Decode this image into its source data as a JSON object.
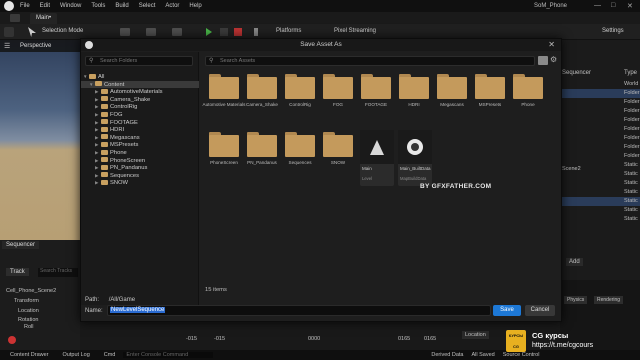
{
  "menubar": {
    "items": [
      "File",
      "Edit",
      "Window",
      "Tools",
      "Build",
      "Select",
      "Actor",
      "Help"
    ],
    "app_title": "SoM_Phone",
    "window_controls": [
      "minimize-icon",
      "maximize-icon",
      "close-icon"
    ]
  },
  "tabs": {
    "main": "Main•"
  },
  "toolbar": {
    "selection_mode": "Selection Mode",
    "platforms": "Platforms",
    "pixel_streaming": "Pixel Streaming",
    "settings": "Settings"
  },
  "viewport": {
    "mode": "Perspective"
  },
  "outliner": {
    "header_left": "Sequencer",
    "header_type": "Type",
    "rows": [
      "World",
      "Folder",
      "Folder",
      "Folder",
      "Folder",
      "Folder",
      "Folder",
      "Folder",
      "Folder",
      "Static",
      "Static",
      "Static",
      "Static",
      "Static",
      "Static",
      "Static"
    ],
    "scene_label": "Scene2",
    "add_label": "Add",
    "details_tabs": [
      "Physics",
      "Rendering"
    ]
  },
  "sequencer": {
    "title": "Sequencer",
    "track_button": "Track",
    "search_placeholder": "Search Tracks",
    "items": [
      "Cell_Phone_Scene2",
      "Transform",
      "Location",
      "Rotation",
      "Roll"
    ],
    "timeline_labels": [
      "-015",
      "-015",
      "0000",
      "0165",
      "0165"
    ],
    "location_label": "Location"
  },
  "status": {
    "content_drawer": "Content Drawer",
    "output_log": "Output Log",
    "cmd": "Cmd",
    "console_placeholder": "Enter Console Command",
    "derived_data": "Derived Data",
    "all_saved": "All Saved",
    "source_control": "Source Control"
  },
  "dialog": {
    "title": "Save Asset As",
    "folder_search_placeholder": "Search Folders",
    "asset_search_placeholder": "Search Assets",
    "tree": [
      {
        "label": "All",
        "depth": 0,
        "expanded": true
      },
      {
        "label": "Content",
        "depth": 1,
        "expanded": true,
        "selected": true
      },
      {
        "label": "AutomotiveMaterials",
        "depth": 2
      },
      {
        "label": "Camera_Shake",
        "depth": 2
      },
      {
        "label": "ControlRig",
        "depth": 2
      },
      {
        "label": "FOG",
        "depth": 2
      },
      {
        "label": "FOOTAGE",
        "depth": 2
      },
      {
        "label": "HDRI",
        "depth": 2
      },
      {
        "label": "Megascans",
        "depth": 2
      },
      {
        "label": "MSPresets",
        "depth": 2
      },
      {
        "label": "Phone",
        "depth": 2
      },
      {
        "label": "PhoneScreen",
        "depth": 2
      },
      {
        "label": "PN_Pandanus",
        "depth": 2
      },
      {
        "label": "Sequences",
        "depth": 2
      },
      {
        "label": "SNOW",
        "depth": 2
      }
    ],
    "folders_row1": [
      "Automotive Materials",
      "Camera_Shake",
      "ControlRig",
      "FOG",
      "FOOTAGE",
      "HDRI",
      "Megascans",
      "MSPresets",
      "Phone"
    ],
    "folders_row2": [
      "PhoneScreen",
      "PN_Pandanus",
      "Sequences",
      "SNOW"
    ],
    "assets": [
      {
        "name": "Main",
        "type": "Level"
      },
      {
        "name": "Main_BuiltData",
        "type": "MapBuildData"
      }
    ],
    "watermark": "BY GFXFATHER.COM",
    "items_count": "15 items",
    "view_options": "View Options",
    "path_label": "Path:",
    "path_value": "/All/Game",
    "name_label": "Name:",
    "name_value": "NewLevelSequence",
    "save": "Save",
    "cancel": "Cancel"
  },
  "promo": {
    "badge": "КУРСЫ CG",
    "line1": "CG курсы",
    "line2": "https://t.me/cgcours"
  }
}
